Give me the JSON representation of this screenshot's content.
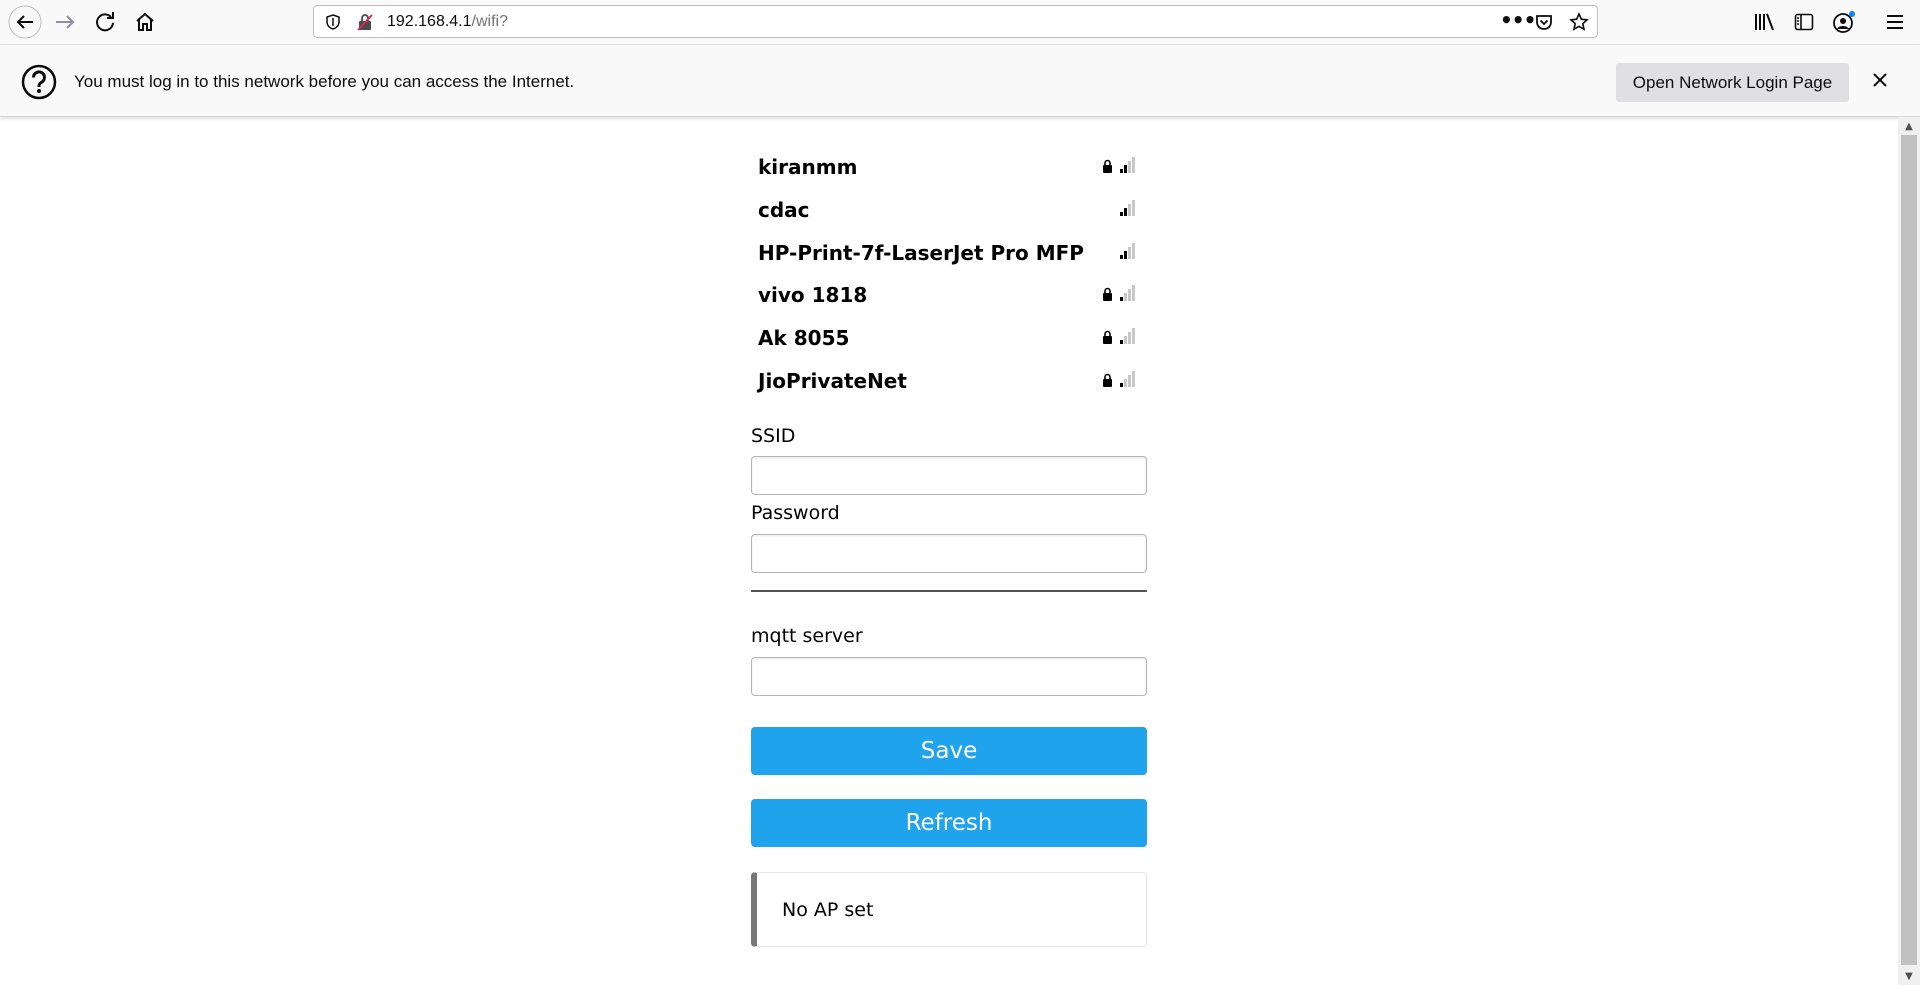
{
  "browser": {
    "url_host": "192.168.4.1",
    "url_path": "/wifi?"
  },
  "notification": {
    "message": "You must log in to this network before you can access the Internet.",
    "button_label": "Open Network Login Page"
  },
  "networks": [
    {
      "name": "kiranmm",
      "locked": true,
      "signal_bars": 2
    },
    {
      "name": "cdac",
      "locked": false,
      "signal_bars": 2
    },
    {
      "name": "HP-Print-7f-LaserJet Pro MFP",
      "locked": false,
      "signal_bars": 2
    },
    {
      "name": "vivo 1818",
      "locked": true,
      "signal_bars": 1
    },
    {
      "name": "Ak 8055",
      "locked": true,
      "signal_bars": 1
    },
    {
      "name": "JioPrivateNet",
      "locked": true,
      "signal_bars": 1
    }
  ],
  "form": {
    "ssid_label": "SSID",
    "ssid_value": "",
    "password_label": "Password",
    "password_value": "",
    "mqtt_label": "mqtt server",
    "mqtt_value": "",
    "save_label": "Save",
    "refresh_label": "Refresh"
  },
  "status": {
    "message": "No AP set"
  },
  "colors": {
    "button": "#1fa3ec",
    "status_border": "#777777"
  }
}
